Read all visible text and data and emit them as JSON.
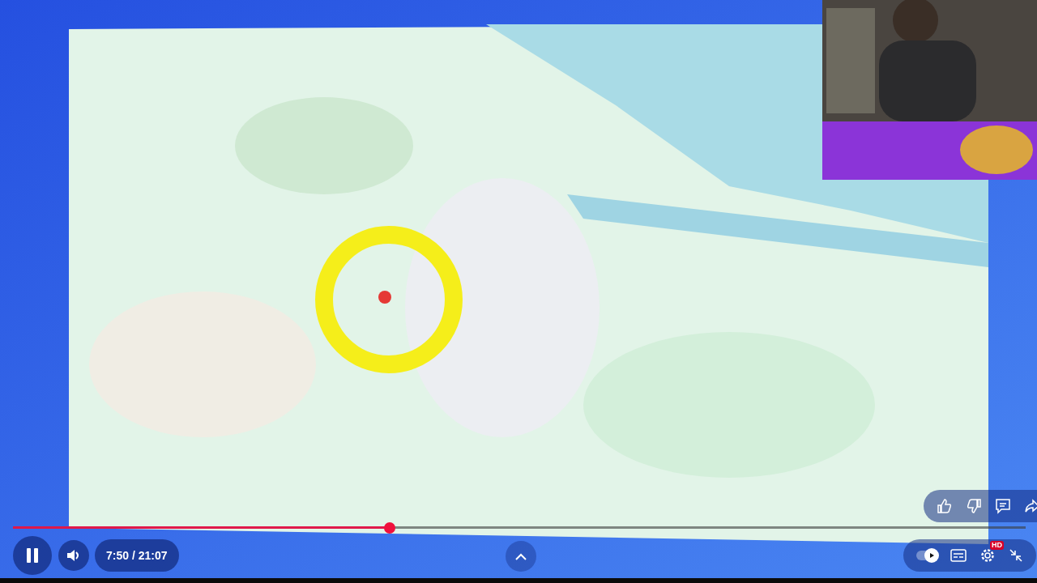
{
  "progress": {
    "level": 0.372
  },
  "player": {
    "playing": true,
    "time": "7:50 / 21:07",
    "quality_badge": "HD",
    "autoplay": true
  }
}
